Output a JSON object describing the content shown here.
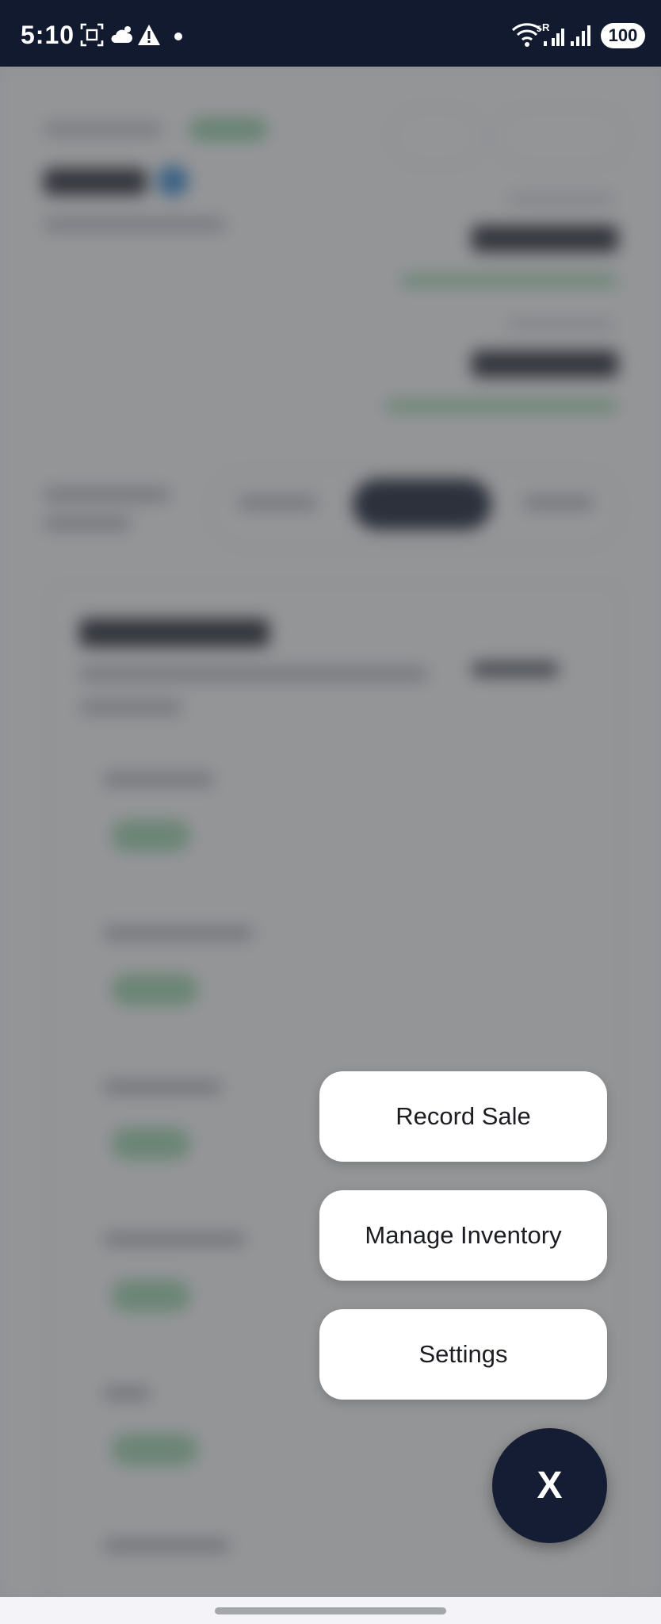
{
  "status_bar": {
    "time": "5:10",
    "battery": "100",
    "icons": [
      "screenshot-icon",
      "cloud-icon",
      "warning-icon",
      "dot-icon",
      "wifi-icon",
      "signal-r-icon",
      "signal-icon",
      "battery-icon"
    ]
  },
  "menu": {
    "items": [
      {
        "label": "Record Sale"
      },
      {
        "label": "Manage Inventory"
      },
      {
        "label": "Settings"
      }
    ],
    "close_label": "X"
  },
  "colors": {
    "status_bar_bg": "#111a2e",
    "fab_bg": "#141d33",
    "menu_button_bg": "#ffffff",
    "accent_green": "#3fa866",
    "accent_blue": "#3b8fd6"
  }
}
